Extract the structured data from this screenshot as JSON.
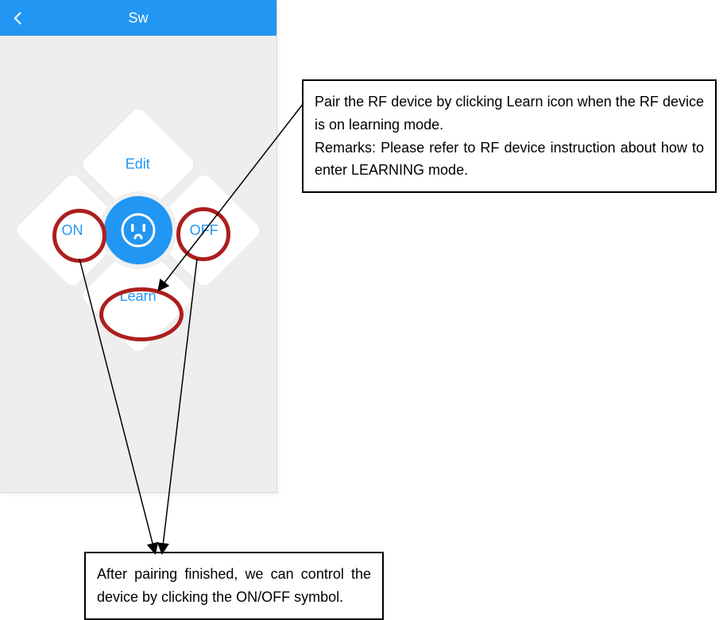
{
  "header": {
    "title": "Sw"
  },
  "pad": {
    "top": "Edit",
    "bottom": "Learn",
    "left": "ON",
    "right": "OFF"
  },
  "callouts": {
    "top": "Pair the RF device by clicking Learn icon when the RF device is on learning mode.\nRemarks: Please refer to RF device instruction about how to enter LEARNING mode.",
    "bottom": "After pairing finished, we can control the device by clicking the ON/OFF symbol."
  }
}
